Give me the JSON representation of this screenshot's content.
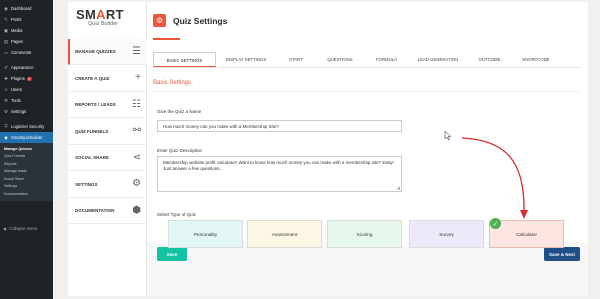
{
  "wp_menu": {
    "items": [
      {
        "icon": "dashboard-icon",
        "glyph": "◉",
        "label": "Dashboard"
      },
      {
        "icon": "posts-icon",
        "glyph": "✎",
        "label": "Posts"
      },
      {
        "icon": "media-icon",
        "glyph": "▣",
        "label": "Media"
      },
      {
        "icon": "pages-icon",
        "glyph": "▤",
        "label": "Pages"
      },
      {
        "icon": "comments-icon",
        "glyph": "▭",
        "label": "Comments"
      },
      {
        "icon": "appearance-icon",
        "glyph": "✐",
        "label": "Appearance"
      },
      {
        "icon": "plugins-icon",
        "glyph": "✚",
        "label": "Plugins",
        "badge": "3"
      },
      {
        "icon": "users-icon",
        "glyph": "☺",
        "label": "Users"
      },
      {
        "icon": "tools-icon",
        "glyph": "⚒",
        "label": "Tools"
      },
      {
        "icon": "settings-icon",
        "glyph": "⚙",
        "label": "Settings"
      },
      {
        "icon": "loginizer-icon",
        "glyph": "⛨",
        "label": "Loginizer Security"
      },
      {
        "icon": "smartquizbuilder-icon",
        "glyph": "◆",
        "label": "Smartquizbuilder"
      }
    ],
    "submenu": [
      "Manage Quizzes",
      "Quiz Funnels",
      "Reports",
      "Manage leads",
      "Social Share",
      "Settings",
      "Documentation"
    ],
    "collapse_label": "Collapse menu"
  },
  "logo": {
    "smart_1": "SM",
    "smart_a": "A",
    "smart_2": "RT",
    "subtitle": "Quiz Builder"
  },
  "plugin_nav": [
    {
      "label": "MANAGE QUIZZES",
      "icon": "menu-icon",
      "glyph": "☰"
    },
    {
      "label": "CREATE A QUIZ",
      "icon": "plus-icon",
      "glyph": "+"
    },
    {
      "label": "REPORTS / LEADS",
      "icon": "list-icon",
      "glyph": "☷"
    },
    {
      "label": "QUIZ FUNNELS",
      "icon": "link-icon",
      "glyph": "⚯"
    },
    {
      "label": "SOCIAL SHARE",
      "icon": "share-icon",
      "glyph": "⋖"
    },
    {
      "label": "SETTINGS",
      "icon": "gear-icon",
      "glyph": "⚙"
    },
    {
      "label": "DOCUMENTATION",
      "icon": "cube-icon",
      "glyph": "⬢"
    }
  ],
  "header": {
    "title": "Quiz Settings",
    "icon_glyph": "⚙"
  },
  "tabs": [
    "BASIC SETTINGS",
    "DISPLAY SETTINGS",
    "START",
    "QUESTIONS",
    "FORMULA",
    "LEAD GENERATION",
    "OUTCOME",
    "SHORTCODE"
  ],
  "section_title": "Basic Settings",
  "form": {
    "name_label": "Give the Quiz a Name",
    "name_value": "How much money can you make with a Membership Site?",
    "desc_label": "Enter Quiz Description",
    "desc_value": "Membership website profit calculator! Want to know how much money you can make with a membership site? Easy! Just answer a few questions..",
    "type_label": "Select Type of Quiz",
    "types": [
      {
        "label": "Personality",
        "color": "#e2f6f6"
      },
      {
        "label": "Assessment",
        "color": "#fbf7e4"
      },
      {
        "label": "Scoring",
        "color": "#e6f7ec"
      },
      {
        "label": "Survey",
        "color": "#ece9fb"
      },
      {
        "label": "Calculator",
        "color": "#fde6e2"
      }
    ],
    "selected_type": "Calculator"
  },
  "buttons": {
    "save": "Save",
    "save_next": "Save & Next"
  },
  "colors": {
    "accent": "#e8573b",
    "save": "#12c2a0",
    "save_next": "#1f4f86",
    "wp_active": "#2271b1"
  }
}
